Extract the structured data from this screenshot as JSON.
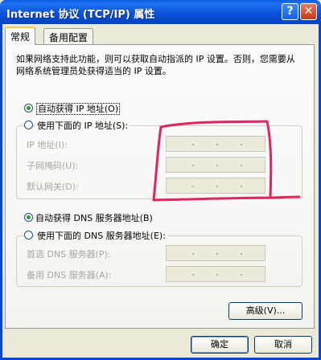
{
  "window": {
    "title": "Internet 协议 (TCP/IP) 属性",
    "help_label": "?",
    "close_label": "✕"
  },
  "tabs": [
    {
      "label": "常规",
      "active": true
    },
    {
      "label": "备用配置",
      "active": false
    }
  ],
  "description": "如果网络支持此功能，则可以获取自动指派的 IP 设置。否则，您需要从网络系统管理员处获得适当的 IP 设置。",
  "ip_section": {
    "auto_label": "自动获得 IP 地址(O)",
    "auto_selected": true,
    "manual_label": "使用下面的 IP 地址(S):",
    "manual_selected": false,
    "fields": [
      {
        "label": "IP 地址(I):",
        "value": ""
      },
      {
        "label": "子网掩码(U):",
        "value": ""
      },
      {
        "label": "默认网关(D):",
        "value": ""
      }
    ]
  },
  "dns_section": {
    "auto_label": "自动获得 DNS 服务器地址(B)",
    "auto_selected": true,
    "manual_label": "使用下面的 DNS 服务器地址(E):",
    "manual_selected": false,
    "fields": [
      {
        "label": "首选 DNS 服务器(P):",
        "value": ""
      },
      {
        "label": "备用 DNS 服务器(A):",
        "value": ""
      }
    ]
  },
  "buttons": {
    "advanced": "高级(V)...",
    "ok": "确定",
    "cancel": "取消"
  },
  "colors": {
    "annotation": "#e0245e",
    "title_bar": "#0b52d8",
    "radio_dot": "#21a121"
  }
}
